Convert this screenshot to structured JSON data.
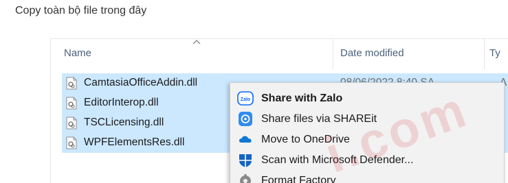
{
  "caption": "Copy toàn bộ file trong đây",
  "headers": {
    "name": "Name",
    "date": "Date modified",
    "type": "Ty"
  },
  "files": [
    {
      "name": "CamtasiaOfficeAddin.dll",
      "date": "08/06/2022 8:40 SA",
      "type": "A"
    },
    {
      "name": "EditorInterop.dll"
    },
    {
      "name": "TSCLicensing.dll"
    },
    {
      "name": "WPFElementsRes.dll"
    }
  ],
  "context_menu": [
    {
      "label": "Share with Zalo",
      "icon": "zalo-icon"
    },
    {
      "label": "Share files via SHAREit",
      "icon": "shareit-icon"
    },
    {
      "label": "Move to OneDrive",
      "icon": "onedrive-icon"
    },
    {
      "label": "Scan with Microsoft Defender...",
      "icon": "defender-shield-icon"
    },
    {
      "label": "Format Factory",
      "icon": "format-factory-icon"
    }
  ],
  "colors": {
    "selection": "#cce8ff",
    "menu_bg": "#f2f2f2",
    "zalo_blue": "#0a68fe",
    "watermark": "#d21e28"
  },
  "watermark": "i.com"
}
